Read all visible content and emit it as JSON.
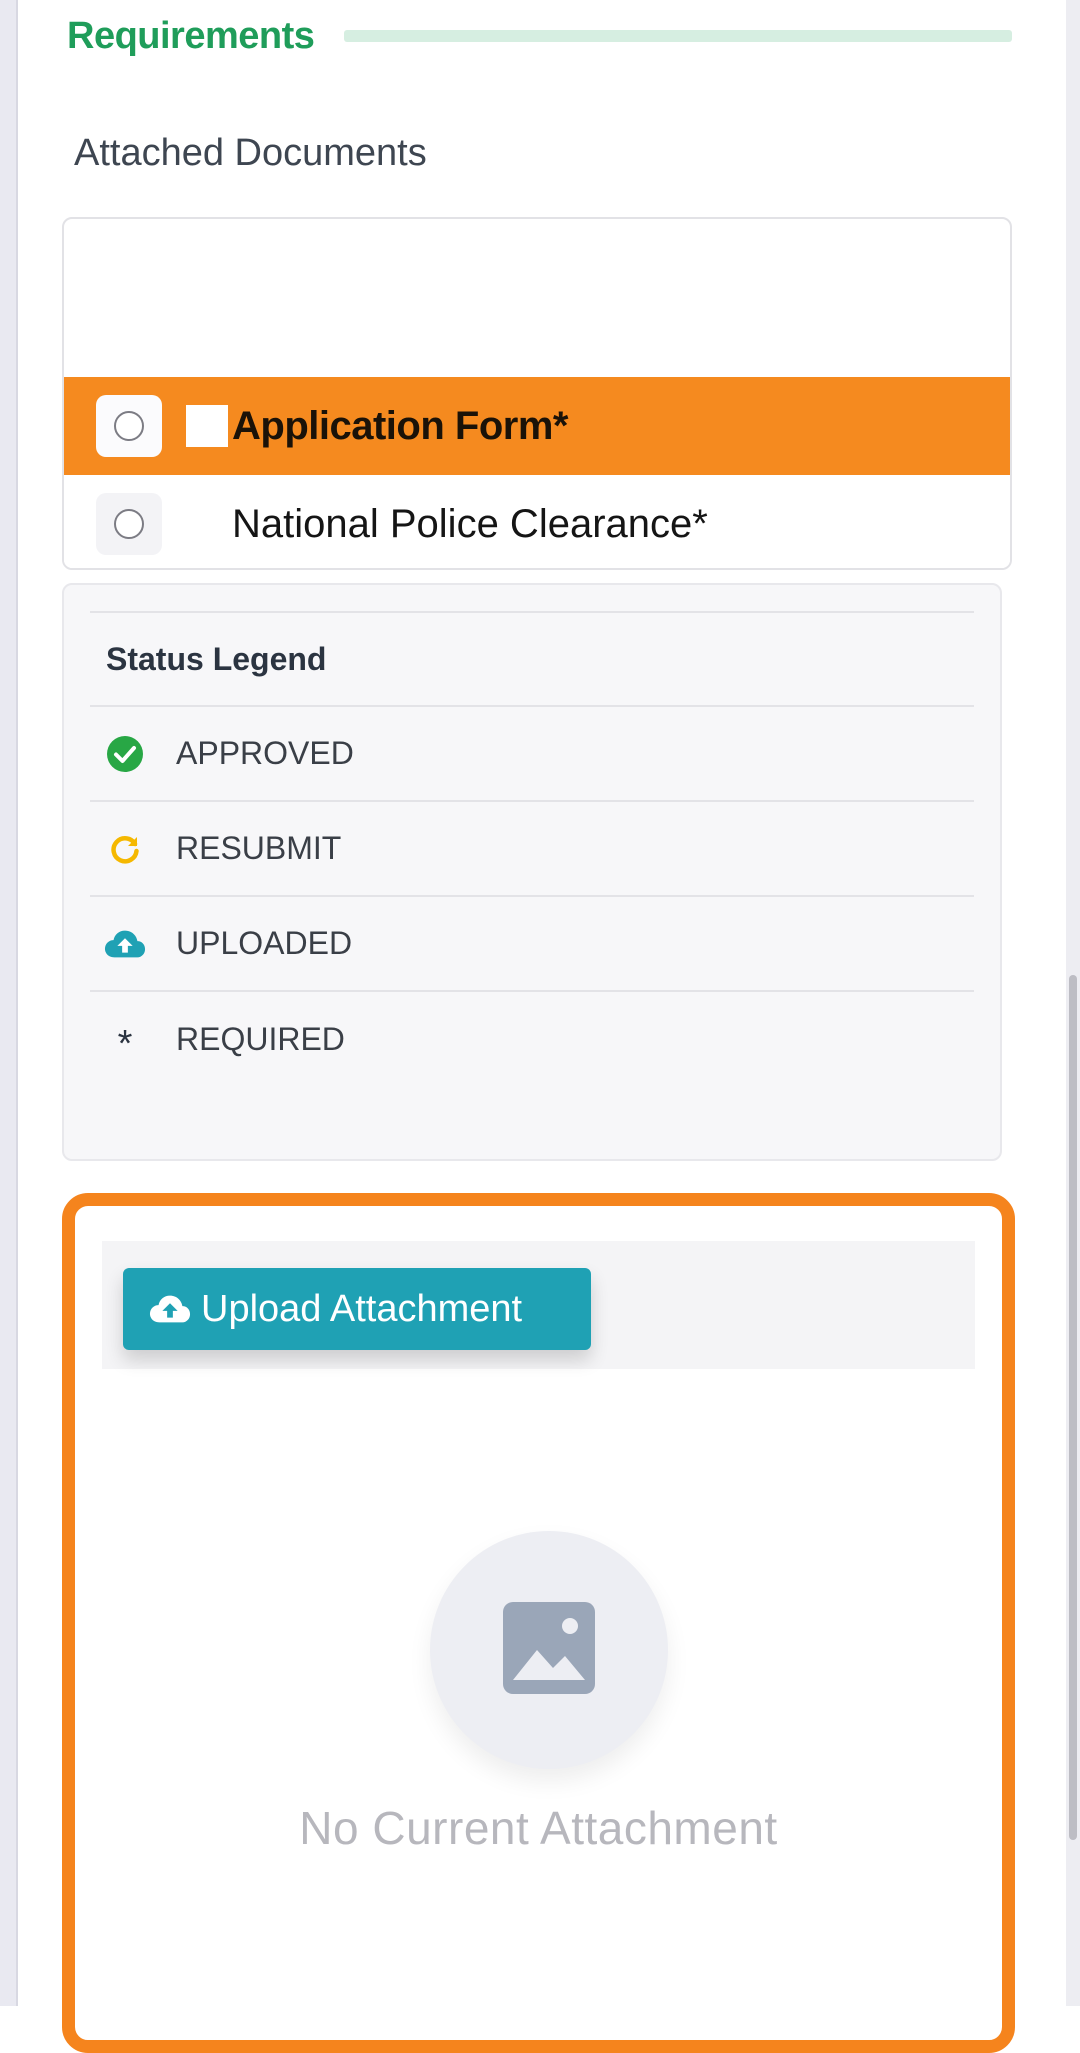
{
  "section": {
    "title": "Requirements"
  },
  "attached": {
    "label": "Attached Documents",
    "documents": [
      {
        "name": "Application Form*",
        "selected": true
      },
      {
        "name": "National Police Clearance*",
        "selected": false
      }
    ]
  },
  "legend": {
    "title": "Status Legend",
    "items": [
      {
        "icon": "check-circle-icon",
        "color": "#28a745",
        "label": "APPROVED"
      },
      {
        "icon": "refresh-icon",
        "color": "#f5b800",
        "label": "RESUBMIT"
      },
      {
        "icon": "cloud-upload-icon",
        "color": "#1fa1b4",
        "label": "UPLOADED"
      },
      {
        "icon": "asterisk-icon",
        "symbol": "*",
        "label": "REQUIRED"
      }
    ]
  },
  "upload": {
    "button_label": "Upload Attachment",
    "empty_text": "No Current Attachment"
  },
  "colors": {
    "accent_orange": "#f5841d",
    "brand_green": "#1f9d5a",
    "teal": "#1fa1b4"
  }
}
